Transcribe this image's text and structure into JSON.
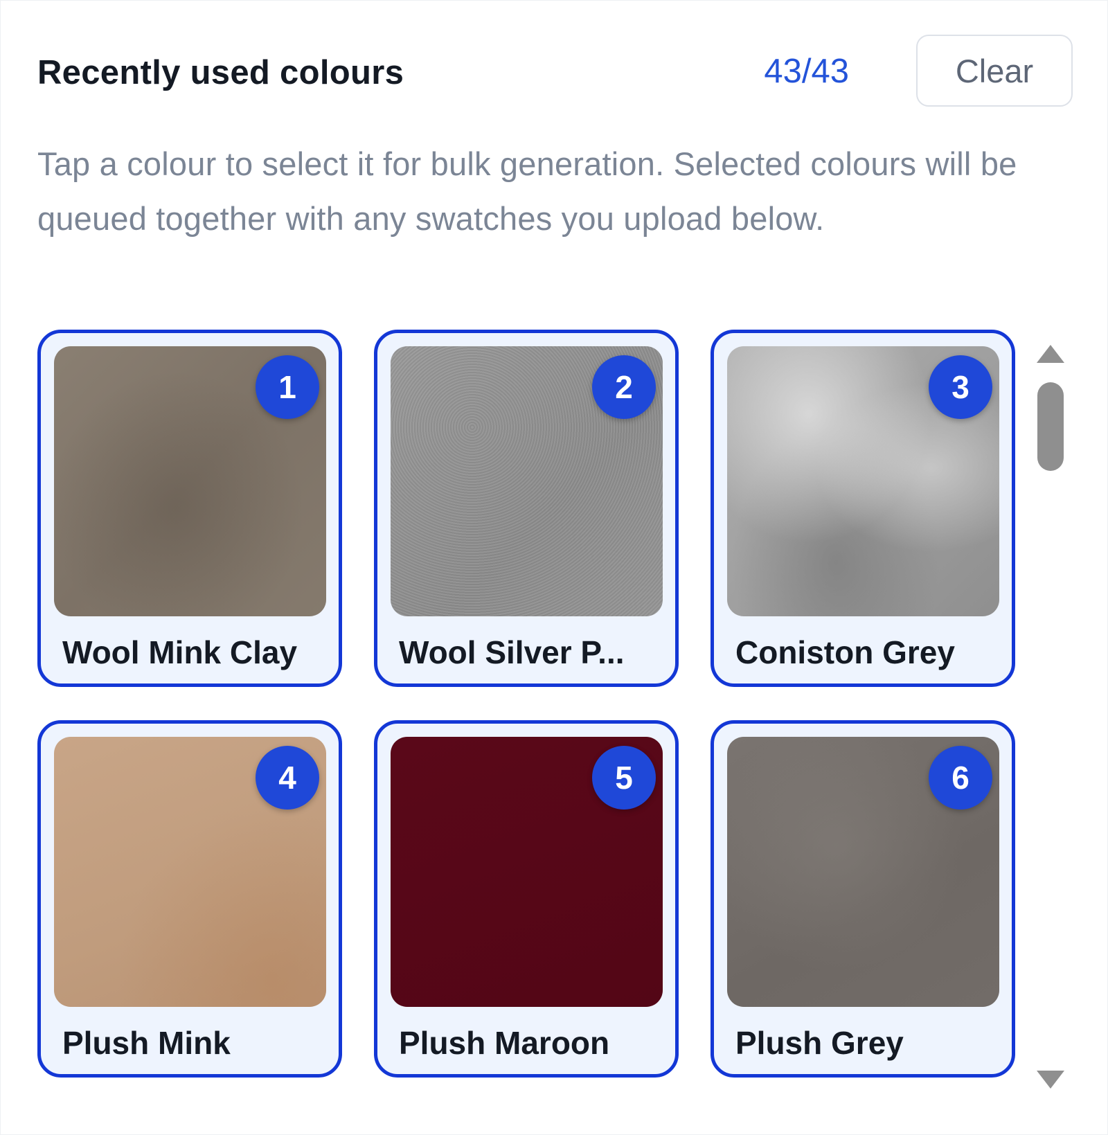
{
  "header": {
    "title": "Recently used colours",
    "count": "43/43",
    "clear_label": "Clear"
  },
  "description": "Tap a colour to select it for bulk generation. Selected colours will be queued together with any swatches you upload below.",
  "swatches": [
    {
      "order": "1",
      "name": "Wool Mink Clay",
      "color": "#827769",
      "selected": true
    },
    {
      "order": "2",
      "name": "Wool Silver P...",
      "color": "#939393",
      "selected": true
    },
    {
      "order": "3",
      "name": "Coniston Grey",
      "color": "#a3a3a3",
      "selected": true
    },
    {
      "order": "4",
      "name": "Plush Mink",
      "color": "#c4a080",
      "selected": true
    },
    {
      "order": "5",
      "name": "Plush Maroon",
      "color": "#560717",
      "selected": true
    },
    {
      "order": "6",
      "name": "Plush Grey",
      "color": "#736d69",
      "selected": true
    }
  ],
  "colors": {
    "accent": "#1337d6",
    "badge": "#1f48d8",
    "count": "#2353d9",
    "tile_bg": "#eef4fe"
  }
}
